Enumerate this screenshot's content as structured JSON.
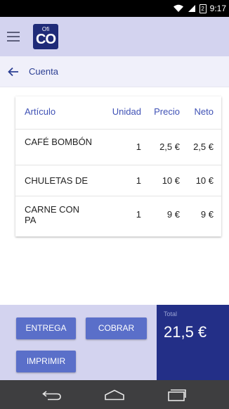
{
  "status_bar": {
    "time": "9:17",
    "battery_level": "2"
  },
  "app_bar": {
    "logo_top": "Ofi",
    "logo_main": "CO"
  },
  "back_bar": {
    "title": "Cuenta"
  },
  "table": {
    "headers": {
      "articulo": "Artículo",
      "unidad": "Unidad",
      "precio": "Precio",
      "neto": "Neto"
    },
    "rows": [
      {
        "articulo": "CAFÉ BOMBÓN",
        "unidad": "1",
        "precio": "2,5 €",
        "neto": "2,5 €"
      },
      {
        "articulo": "CHULETAS DE",
        "unidad": "1",
        "precio": "10 €",
        "neto": "10 €"
      },
      {
        "articulo": "CARNE CON PA",
        "unidad": "1",
        "precio": "9 €",
        "neto": "9 €"
      }
    ]
  },
  "actions": {
    "entrega_label": "ENTREGA",
    "cobrar_label": "COBRAR",
    "imprimir_label": "IMPRIMIR"
  },
  "total": {
    "label": "Total",
    "value": "21,5 €"
  },
  "colors": {
    "app_bar": "#d3d3ef",
    "accent": "#3f51b5",
    "button": "#5a6fc9",
    "total_panel": "#232f87"
  },
  "icons": [
    "wifi-icon",
    "signal-icon",
    "battery-icon",
    "menu-icon",
    "back-arrow-icon",
    "nav-back-icon",
    "nav-home-icon",
    "nav-recents-icon"
  ]
}
